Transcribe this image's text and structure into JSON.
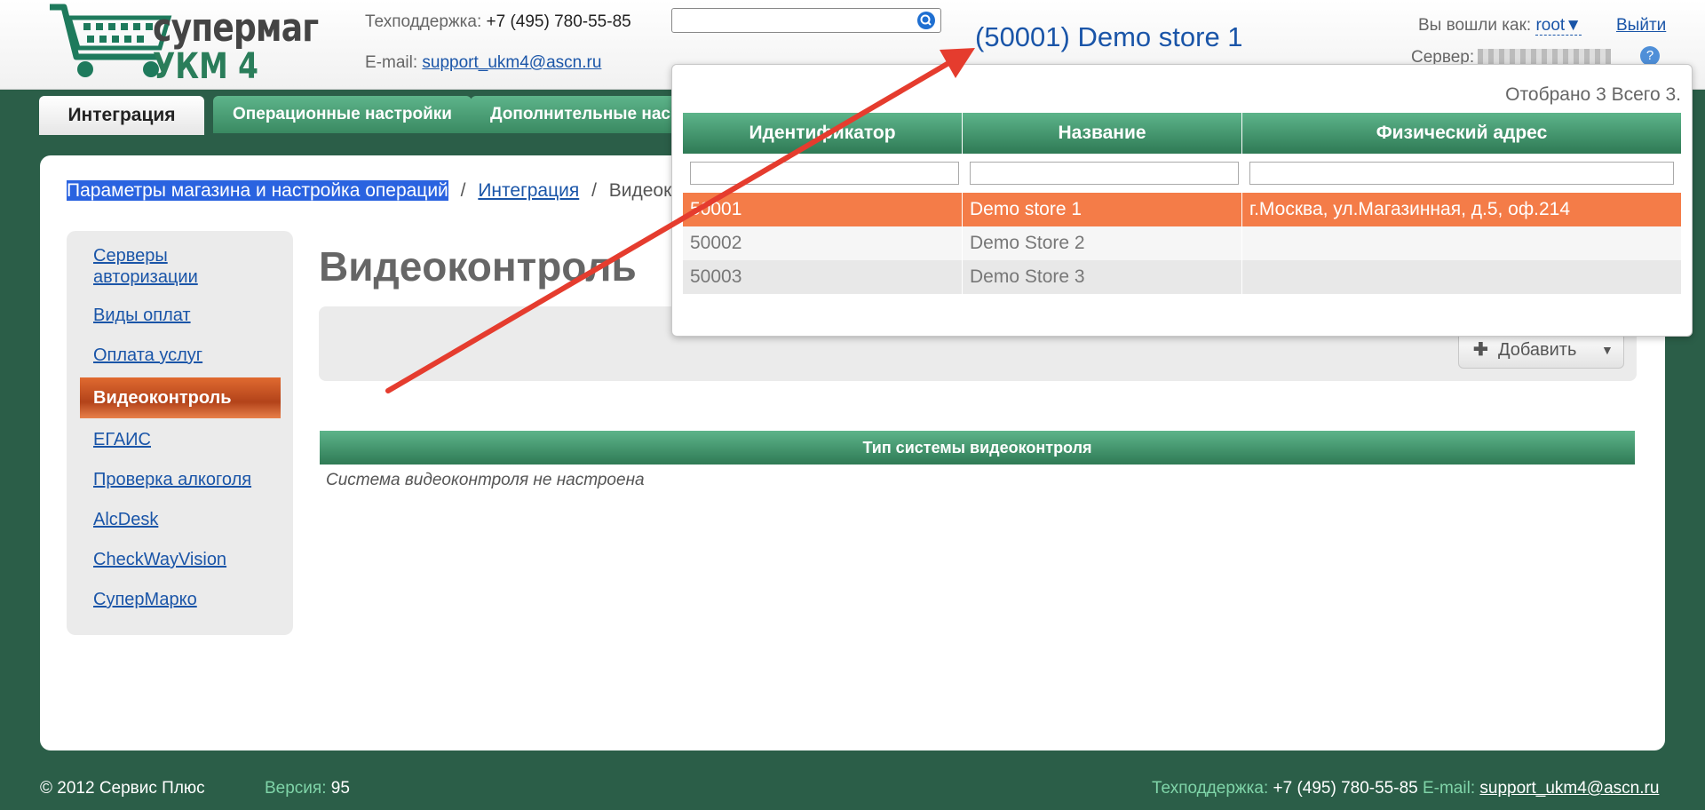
{
  "header": {
    "logo_line1": "супермаг",
    "logo_line2": "УКМ 4",
    "support_label": "Техподдержка:",
    "support_phone": "+7 (495) 780-55-85",
    "email_label": "E-mail:",
    "email": "support_ukm4@ascn.ru",
    "search_value": "",
    "store_title": "(50001) Demo store 1",
    "logged_in_label": "Вы вошли как:",
    "user": "root▼",
    "logout": "Выйти",
    "server_label": "Сервер:",
    "help": "?"
  },
  "tabs": [
    {
      "label": "Интеграция"
    },
    {
      "label": "Операционные настройки"
    },
    {
      "label": "Дополнительные нас"
    }
  ],
  "breadcrumb": {
    "item1": "Параметры магазина и настройка операций",
    "sep": "/",
    "item2": "Интеграция",
    "item3": "Видеок"
  },
  "sidebar": {
    "items": [
      {
        "label": "Серверы авторизации"
      },
      {
        "label": "Виды оплат"
      },
      {
        "label": "Оплата услуг"
      },
      {
        "label": "Видеоконтроль"
      },
      {
        "label": "ЕГАИС"
      },
      {
        "label": "Проверка алкоголя"
      },
      {
        "label": "AlcDesk"
      },
      {
        "label": "CheckWayVision"
      },
      {
        "label": "СуперМарко"
      }
    ]
  },
  "main": {
    "title": "Видеоконтроль",
    "add_button": "Добавить",
    "table_header": "Тип системы видеоконтроля",
    "empty_text": "Система видеоконтроля не настроена"
  },
  "popup": {
    "count_text": "Отобрано 3 Всего 3.",
    "columns": [
      "Идентификатор",
      "Название",
      "Физический адрес"
    ],
    "rows": [
      {
        "id": "50001",
        "name": "Demo store 1",
        "address": "г.Москва, ул.Магазинная, д.5, оф.214"
      },
      {
        "id": "50002",
        "name": "Demo Store 2",
        "address": ""
      },
      {
        "id": "50003",
        "name": "Demo Store 3",
        "address": ""
      }
    ]
  },
  "footer": {
    "copyright": "© 2012 Сервис Плюс",
    "version_label": "Версия:",
    "version": "95",
    "support_label": "Техподдержка:",
    "support_phone": "+7 (495) 780-55-85",
    "email_label": "E-mail:",
    "email": "support_ukm4@ascn.ru"
  },
  "colors": {
    "brand_green": "#2b5e48",
    "accent_orange": "#f47c48",
    "link_blue": "#1a55a8",
    "arrow_red": "#e53c2e"
  }
}
